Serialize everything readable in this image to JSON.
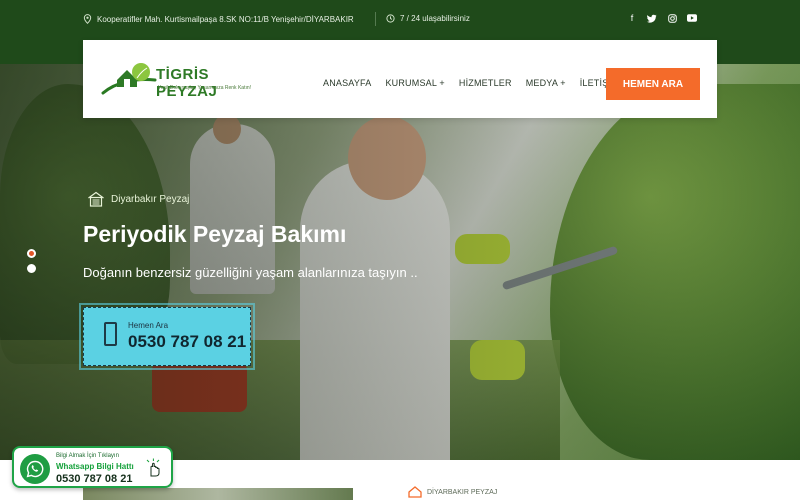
{
  "topbar": {
    "address": "Kooperatifler Mah. Kurtismailpaşa 8.SK NO:11/B Yenişehir/DİYARBAKIR",
    "hours": "7 / 24 ulaşabilirsiniz",
    "social": [
      "facebook-icon",
      "twitter-icon",
      "instagram-icon",
      "youtube-icon"
    ]
  },
  "header": {
    "logo_name": "TİGRİS PEYZAJ",
    "logo_tagline": "Yeşil Dokunuşlar, Yaşamınıza Renk Katın!",
    "nav": [
      "ANASAYFA",
      "KURUMSAL +",
      "HİZMETLER",
      "MEDYA +",
      "İLETİŞİM"
    ],
    "cta": "HEMEN ARA"
  },
  "hero": {
    "label": "Diyarbakır Peyzaj",
    "title": "Periyodik Peyzaj Bakımı",
    "subtitle": "Doğanın benzersiz güzelliğini yaşam alanlarınıza taşıyın ..",
    "call_small": "Hemen Ara",
    "call_number": "0530 787 08 21",
    "slide_count": 2,
    "active_slide": 1
  },
  "bottom": {
    "section_label": "DİYARBAKIR PEYZAJ"
  },
  "whatsapp": {
    "line1": "Bilgi Almak İçin Tıklayın",
    "line2": "Whatsapp Bilgi Hattı",
    "number": "0530 787 08 21"
  },
  "colors": {
    "topbar": "#1f4a1a",
    "brand_green": "#2e7a26",
    "cta_orange": "#f46b2a",
    "callbox": "#5bd1e3",
    "whatsapp": "#1f9d43"
  }
}
